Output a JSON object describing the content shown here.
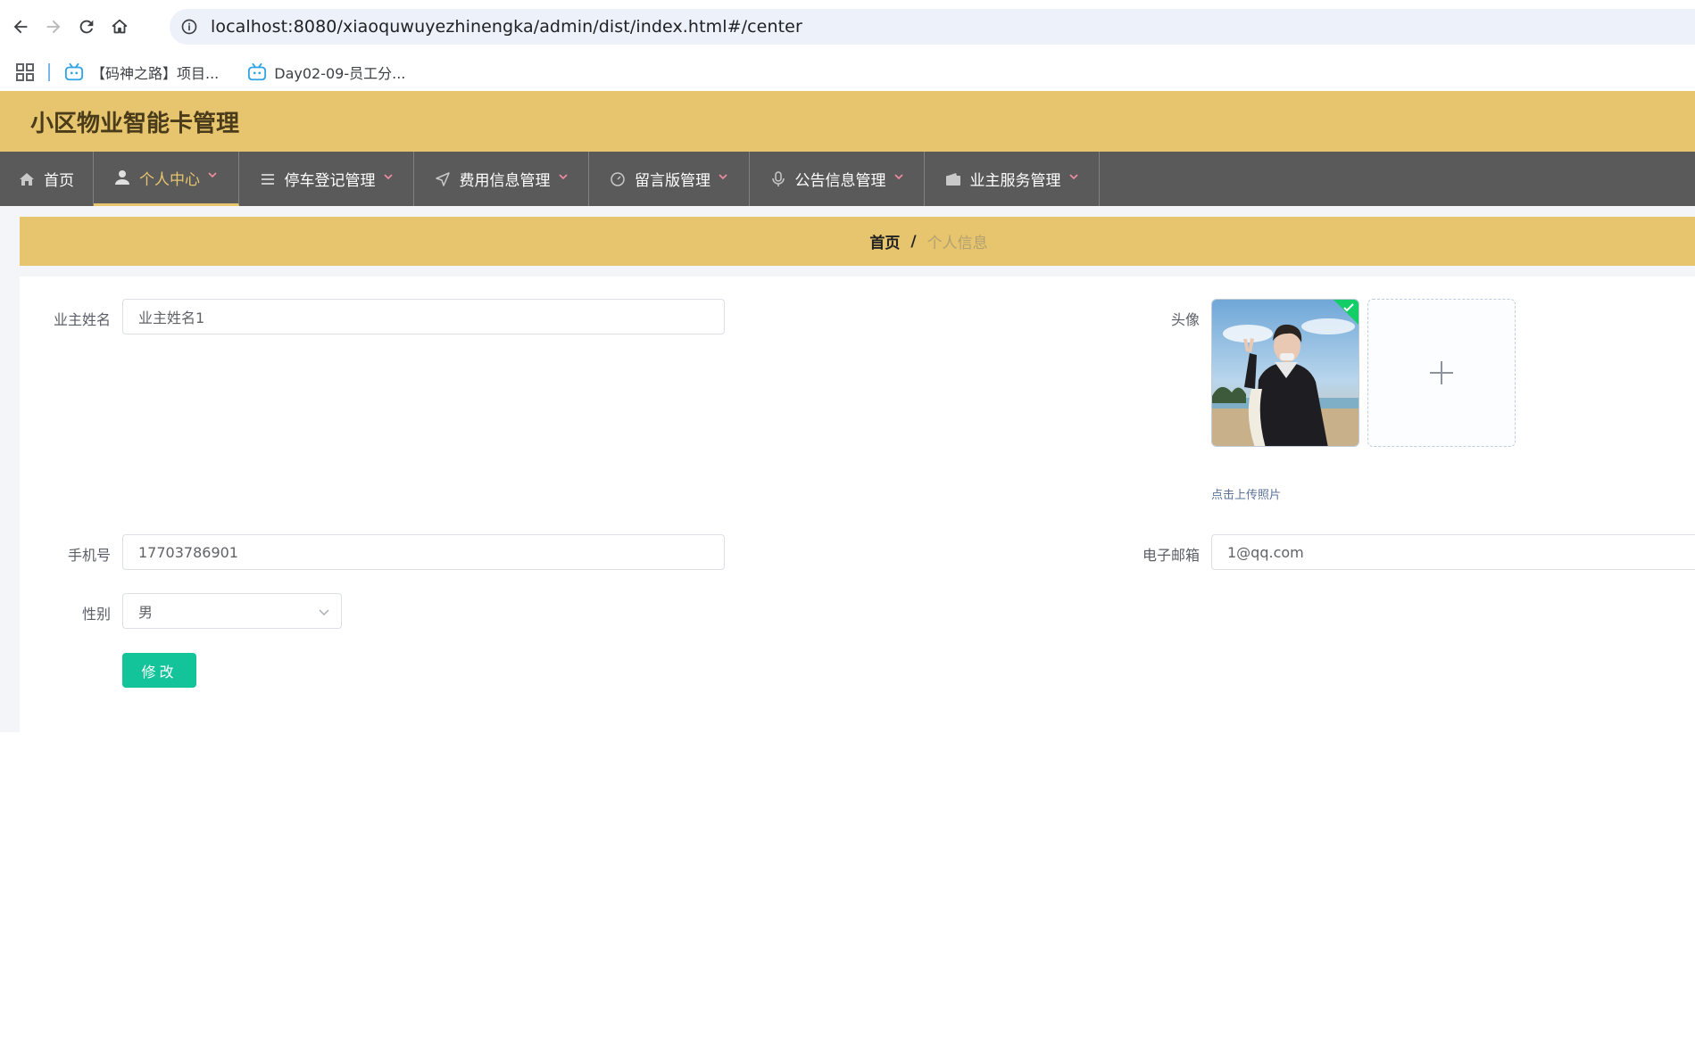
{
  "browser": {
    "url": "localhost:8080/xiaoquwuyezhinengka/admin/dist/index.html#/center",
    "bookmarks": [
      {
        "label": "【码神之路】项目...",
        "icon": "bilibili-icon"
      },
      {
        "label": "Day02-09-员工分...",
        "icon": "bilibili-icon"
      }
    ]
  },
  "app": {
    "title": "小区物业智能卡管理"
  },
  "nav": {
    "items": [
      {
        "label": "首页",
        "icon": "home-icon",
        "dropdown": false,
        "active": false
      },
      {
        "label": "个人中心",
        "icon": "user-icon",
        "dropdown": true,
        "active": true
      },
      {
        "label": "停车登记管理",
        "icon": "list-icon",
        "dropdown": true,
        "active": false
      },
      {
        "label": "费用信息管理",
        "icon": "send-icon",
        "dropdown": true,
        "active": false
      },
      {
        "label": "留言版管理",
        "icon": "dashboard-icon",
        "dropdown": true,
        "active": false
      },
      {
        "label": "公告信息管理",
        "icon": "microphone-icon",
        "dropdown": true,
        "active": false
      },
      {
        "label": "业主服务管理",
        "icon": "wallet-icon",
        "dropdown": true,
        "active": false
      }
    ]
  },
  "breadcrumb": {
    "home": "首页",
    "separator": "/",
    "current": "个人信息"
  },
  "form": {
    "owner_name_label": "业主姓名",
    "owner_name_value": "业主姓名1",
    "avatar_label": "头像",
    "upload_hint": "点击上传照片",
    "phone_label": "手机号",
    "phone_value": "17703786901",
    "email_label": "电子邮箱",
    "email_value": "1@qq.com",
    "gender_label": "性别",
    "gender_value": "男",
    "submit_label": "修改"
  },
  "colors": {
    "header_bg": "#e6c56e",
    "nav_bg": "#5b5a5a",
    "button_bg": "#13c39a",
    "success_badge": "#13ce66"
  }
}
